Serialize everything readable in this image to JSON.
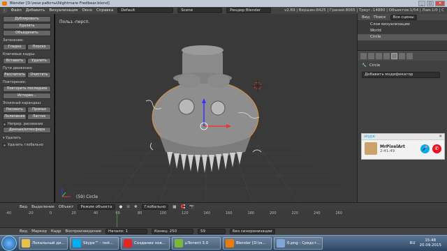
{
  "window": {
    "title": "Blender [D:\\мои работы\\Nightmare Fredbear.blend]"
  },
  "menubar": {
    "items": [
      "Файл",
      "Добавить",
      "Визуализация",
      "Окно",
      "Справка"
    ],
    "layout": "Default",
    "scene": "Scene",
    "engine": "Рендер Blender",
    "stats": "v2.69 | Вершин:8425 | Граней:8065 | Треуг.:14880 | Объектов:1/54 | Лам:1/0 | C"
  },
  "tool_shelf": {
    "btn_duplicate": "Дублировать",
    "btn_delete": "Удалить",
    "btn_join": "Объединить",
    "shading_label": "Затенение:",
    "btn_smooth": "Гладко",
    "btn_flat": "Плоско",
    "keyframes_label": "Ключевые кадры:",
    "btn_insert": "Вставить",
    "btn_remove": "Удалить",
    "motion_label": "Пути движения:",
    "btn_calc": "Рассчитать",
    "btn_clear": "Очистить",
    "repeat_label": "Повторение:",
    "btn_repeat_last": "Повторить последнее",
    "btn_history": "История...",
    "gpencil_label": "Эскизный карандаш:",
    "btn_draw": "Рисовать",
    "btn_line": "Прямая",
    "btn_poly": "Полилиния",
    "btn_erase": "Ластик",
    "chk_continuous": "Непрер. рисование",
    "btn_sketch": "Данные/атмосфера",
    "delete_header": "▾ Удалить",
    "chk_global": "Удалить глобально"
  },
  "viewport": {
    "view_label": "Польз.-персп.",
    "object_label": "(59) Circle"
  },
  "outliner": {
    "view": "Вид",
    "search": "Поиск",
    "all_scenes": "Все сцены",
    "items": [
      "Слои визуализации",
      "World",
      "Circle"
    ]
  },
  "properties": {
    "object_name": "Circle",
    "add_modifier": "Добавить модификатор"
  },
  "vp_toolbar": {
    "view": "Вид",
    "select": "Выделение",
    "object": "Объект",
    "mode": "Режим объекта",
    "pivot": "Глобально"
  },
  "timeline": {
    "ticks": [
      "-40",
      "-20",
      "0",
      "20",
      "40",
      "60",
      "80",
      "100",
      "120",
      "140",
      "160",
      "180",
      "200",
      "220",
      "240",
      "260"
    ],
    "view": "Вид",
    "marker": "Маркер",
    "frame": "Кадр",
    "playback": "Воспроизведение",
    "start": "Начало: 1",
    "end": "Конец: 250",
    "current": "59",
    "sync": "Без синхронизации"
  },
  "skype_popup": {
    "app": "skype",
    "caller": "MrPixelArt",
    "duration": "2:41:49"
  },
  "taskbar": {
    "items": [
      "Локальный ди...",
      "Skype™ - rost...",
      "Создание нов...",
      "µTorrent 3.0",
      "Blender [D:\\м...",
      "0.png - Средст..."
    ],
    "lang": "RU",
    "time": "15:48",
    "date": "20.09.2015"
  }
}
